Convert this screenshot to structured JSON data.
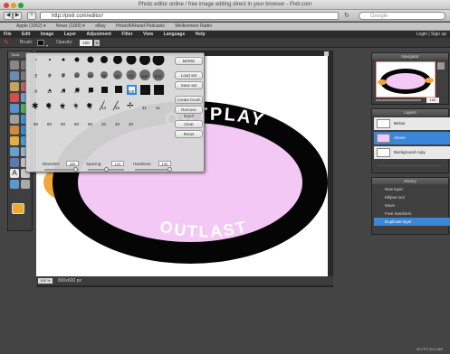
{
  "window": {
    "title": "Photo editor online / free image editing direct in your browser - Pixlr.com"
  },
  "browser": {
    "url": "http://pixlr.com/editor/",
    "search_placeholder": "Google",
    "bookmarks": [
      "Apple (1052) ▾",
      "News (1160) ▾",
      "eBay",
      "HowIsNAhead Podcasts",
      "Wellesmere Radio"
    ]
  },
  "menu": {
    "items": [
      "File",
      "Edit",
      "Image",
      "Layer",
      "Adjustment",
      "Filter",
      "View",
      "Language",
      "Help"
    ],
    "login": "Login",
    "signup": "Sign up"
  },
  "options": {
    "brush_label": "Brush:",
    "opacity_label": "Opacity:",
    "opacity_value": "100"
  },
  "tools_panel": {
    "title": "Tools"
  },
  "brush_popup": {
    "rows": [
      {
        "sizes": [
          1,
          3,
          5,
          9,
          13,
          19,
          27,
          35,
          45
        ],
        "labels": [
          "1",
          "5",
          "9",
          "15",
          "20",
          "25",
          "30",
          "70",
          "100",
          "200"
        ]
      },
      {
        "sizes": [
          1,
          3,
          5,
          9,
          13,
          19,
          27,
          35,
          45
        ],
        "labels": [
          "9",
          "13",
          "25",
          "20",
          "25",
          "30",
          "50",
          "100",
          "150",
          "200"
        ]
      },
      {
        "sizes": [
          1,
          3,
          5,
          9,
          13,
          19,
          27,
          35,
          45
        ],
        "labels": [
          "1",
          "3",
          "5",
          "7",
          "9",
          "13",
          "15",
          "29",
          "31",
          "41"
        ]
      },
      {
        "sizes": [],
        "labels": [
          "90",
          "60",
          "60",
          "60",
          "60",
          "20",
          "40",
          "20"
        ]
      }
    ],
    "buttons": [
      "MORE",
      "Load set",
      "Save set",
      "Create brush",
      "Remove brush",
      "Clear",
      "Reset"
    ],
    "sliders": {
      "diameter_label": "Diameter:",
      "diameter_value": "400",
      "spacing_label": "Spacing:",
      "spacing_value": "120",
      "hardness_label": "Hardness:",
      "hardness_value": "100"
    }
  },
  "canvas": {
    "top_text": "OUTPLAY",
    "bottom_text": "OUTLAST",
    "fill_color": "#f4c8f4",
    "ring_color": "#050505",
    "accent_color": "#f3a73a"
  },
  "statusbar": {
    "zoom": "100 %",
    "size": "800x600 px"
  },
  "navigator": {
    "title": "Navigator",
    "zoom": "100"
  },
  "layers": {
    "title": "Layers",
    "items": [
      {
        "name": "Below",
        "selected": false
      },
      {
        "name": "Above",
        "selected": true
      },
      {
        "name": "Background copy",
        "selected": false
      }
    ]
  },
  "history": {
    "title": "History",
    "items": [
      "New layer",
      "Ellipse tool",
      "Move",
      "Free transform",
      "Duplicate layer"
    ],
    "selected_index": 4
  },
  "footer": {
    "stats": "35 FPS 95.6 MB"
  }
}
